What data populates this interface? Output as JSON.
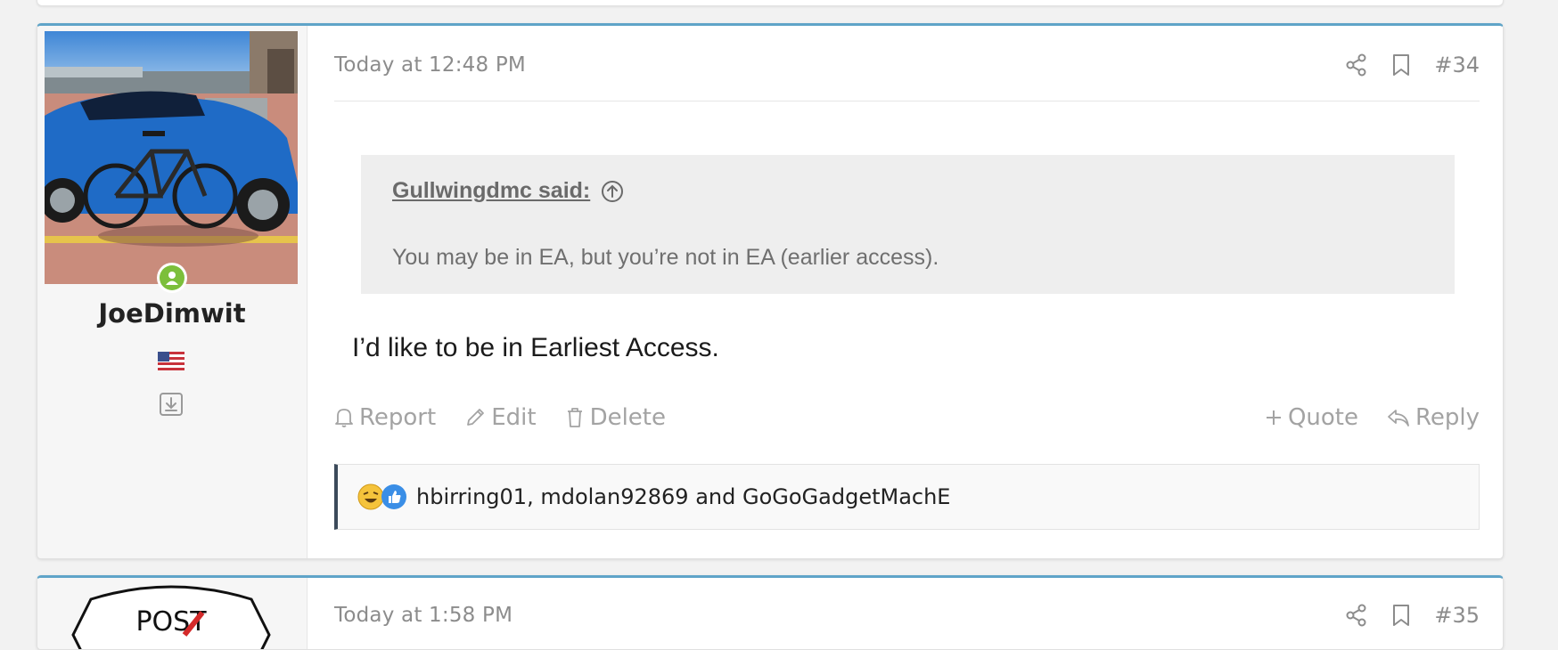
{
  "post_34": {
    "timestamp": "Today at 12:48 PM",
    "post_number": "#34",
    "user": {
      "name": "JoeDimwit",
      "status": "online"
    },
    "quote": {
      "author_label": "Gullwingdmc said:",
      "text": "You may be in EA, but you’re not in EA (earlier access)."
    },
    "message": "I’d like to be in Earliest Access.",
    "actions_left": [
      {
        "label": "Report",
        "icon": "bell-icon"
      },
      {
        "label": "Edit",
        "icon": "pencil-icon"
      },
      {
        "label": "Delete",
        "icon": "trash-icon"
      }
    ],
    "actions_right": [
      {
        "label": "Quote",
        "icon": "plus-icon"
      },
      {
        "label": "Reply",
        "icon": "reply-icon"
      }
    ],
    "reactions": {
      "icons": [
        "laugh-reaction-icon",
        "like-reaction-icon"
      ],
      "text": "hbirring01, mdolan92869 and GoGoGadgetMachE"
    }
  },
  "post_35": {
    "timestamp": "Today at 1:58 PM",
    "post_number": "#35",
    "avatar_text": "POST"
  },
  "colors": {
    "accent_border": "#5fa4c8",
    "online": "#7cbf3b",
    "muted_text": "#8c8c8c",
    "quote_bg": "#eeeeee",
    "reaction_bar": "#3b4a5a"
  }
}
